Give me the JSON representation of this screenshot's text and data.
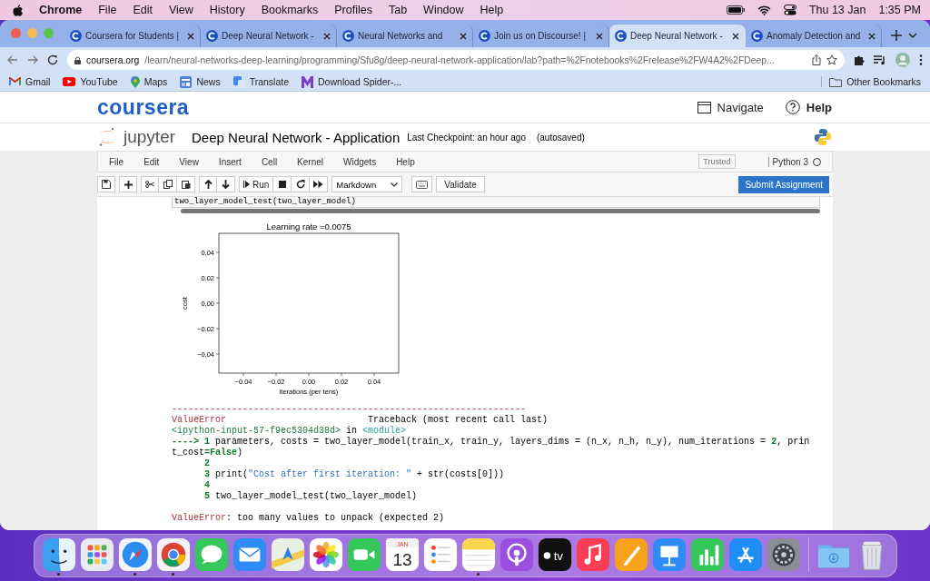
{
  "menu_bar": {
    "app": "Chrome",
    "items": [
      "File",
      "Edit",
      "View",
      "History",
      "Bookmarks",
      "Profiles",
      "Tab",
      "Window",
      "Help"
    ],
    "date": "Thu 13 Jan",
    "time": "1:35 PM"
  },
  "tabs": [
    {
      "title": "Coursera for Students |",
      "selected": false
    },
    {
      "title": "Deep Neural Network -",
      "selected": false
    },
    {
      "title": "Neural Networks and",
      "selected": false
    },
    {
      "title": "Join us on Discourse! |",
      "selected": false
    },
    {
      "title": "Deep Neural Network -",
      "selected": true
    },
    {
      "title": "Anomaly Detection and",
      "selected": false
    }
  ],
  "address_bar": {
    "domain": "coursera.org",
    "path": "/learn/neural-networks-deep-learning/programming/Sfu8g/deep-neural-network-application/lab?path=%2Fnotebooks%2Frelease%2FW4A2%2FDeep..."
  },
  "bookmarks": [
    {
      "label": "Gmail",
      "kind": "gmail"
    },
    {
      "label": "YouTube",
      "kind": "youtube"
    },
    {
      "label": "Maps",
      "kind": "maps"
    },
    {
      "label": "News",
      "kind": "news"
    },
    {
      "label": "Translate",
      "kind": "translate"
    },
    {
      "label": "Download Spider-...",
      "kind": "spider"
    }
  ],
  "other_bookmarks": "Other Bookmarks",
  "site_header": {
    "logo": "coursera",
    "navigate": "Navigate",
    "help": "Help"
  },
  "notebook": {
    "logo": "jupyter",
    "title": "Deep Neural Network - Application",
    "checkpoint": "Last Checkpoint: an hour ago",
    "autosave": "(autosaved)",
    "menu": [
      "File",
      "Edit",
      "View",
      "Insert",
      "Cell",
      "Kernel",
      "Widgets",
      "Help"
    ],
    "trusted": "Trusted",
    "kernel": "Python 3",
    "kernel_busy": false,
    "toolbar": {
      "run": "Run",
      "cell_type": "Markdown",
      "validate": "Validate",
      "submit": "Submit Assignment"
    }
  },
  "cell": {
    "input": "two_layer_model_test(two_layer_model)",
    "chart_data": {
      "type": "line",
      "title": "Learning rate =0.0075",
      "xlabel": "iterations (per tens)",
      "ylabel": "cost",
      "xlim": [
        -0.055,
        0.055
      ],
      "ylim": [
        -0.055,
        0.055
      ],
      "xticks": [
        {
          "value": -0.04,
          "label": "−0.04"
        },
        {
          "value": -0.02,
          "label": "−0.02"
        },
        {
          "value": 0,
          "label": "0.00"
        },
        {
          "value": 0.02,
          "label": "0.02"
        },
        {
          "value": 0.04,
          "label": "0.04"
        }
      ],
      "yticks": [
        {
          "value": 0.04,
          "label": "0.04"
        },
        {
          "value": 0.02,
          "label": "0.02"
        },
        {
          "value": 0,
          "label": "0.00"
        },
        {
          "value": -0.02,
          "label": "−0.02"
        },
        {
          "value": -0.04,
          "label": "−0.04"
        }
      ]
    },
    "traceback": [
      [
        {
          "text": "-----------------------------------------------------------------",
          "kind": "err"
        }
      ],
      [
        {
          "text": "ValueError",
          "kind": "err"
        },
        {
          "text": "                          Traceback (most recent call last)",
          "kind": "plain"
        }
      ],
      [
        {
          "text": "<ipython-input-57-f9ec5304d38d>",
          "kind": "loc"
        },
        {
          "text": " in ",
          "kind": "plain"
        },
        {
          "text": "<module>",
          "kind": "mod"
        }
      ],
      [
        {
          "text": "----> 1",
          "kind": "num"
        },
        {
          "text": " parameters, costs = two_layer_model(train_x, train_y, layers_dims = (n_x, n_h, n_y), num_iterations = ",
          "kind": "plain"
        },
        {
          "text": "2",
          "kind": "num"
        },
        {
          "text": ", prin",
          "kind": "plain"
        }
      ],
      [
        {
          "text": "t_cost",
          "kind": "plain"
        },
        {
          "text": "=False",
          "kind": "num"
        },
        {
          "text": ")",
          "kind": "plain"
        }
      ],
      [
        {
          "text": "      2",
          "kind": "num"
        }
      ],
      [
        {
          "text": "      3",
          "kind": "num"
        },
        {
          "text": " print(",
          "kind": "plain"
        },
        {
          "text": "\"Cost after first iteration: \"",
          "kind": "str"
        },
        {
          "text": " + str(costs[0]))",
          "kind": "plain"
        }
      ],
      [
        {
          "text": "      4",
          "kind": "num"
        }
      ],
      [
        {
          "text": "      5",
          "kind": "num"
        },
        {
          "text": " two_layer_model_test(two_layer_model)",
          "kind": "plain"
        }
      ]
    ],
    "error": [
      {
        "text": "ValueError",
        "kind": "err"
      },
      {
        "text": ": too many values to unpack (expected 2)",
        "kind": "plain"
      }
    ]
  },
  "dock": [
    {
      "kind": "finder",
      "running": true
    },
    {
      "kind": "launchpad",
      "running": false
    },
    {
      "kind": "safari",
      "running": true
    },
    {
      "kind": "chrome",
      "running": true
    },
    {
      "kind": "messages",
      "running": false
    },
    {
      "kind": "mail",
      "running": false
    },
    {
      "kind": "maps",
      "running": false
    },
    {
      "kind": "photos",
      "running": false
    },
    {
      "kind": "facetime",
      "running": false
    },
    {
      "kind": "calendar",
      "month": "JAN",
      "day": "13",
      "running": false
    },
    {
      "kind": "reminders",
      "running": false
    },
    {
      "kind": "notes",
      "running": true
    },
    {
      "kind": "podcasts",
      "running": false
    },
    {
      "kind": "tv",
      "label": "tv",
      "running": false
    },
    {
      "kind": "music",
      "running": false
    },
    {
      "kind": "pages",
      "running": false
    },
    {
      "kind": "keynote",
      "running": false
    },
    {
      "kind": "numbers",
      "running": false
    },
    {
      "kind": "appstore",
      "running": false
    },
    {
      "kind": "settings",
      "running": false
    },
    {
      "kind": "downloads",
      "running": false
    },
    {
      "kind": "trash",
      "running": false
    }
  ]
}
